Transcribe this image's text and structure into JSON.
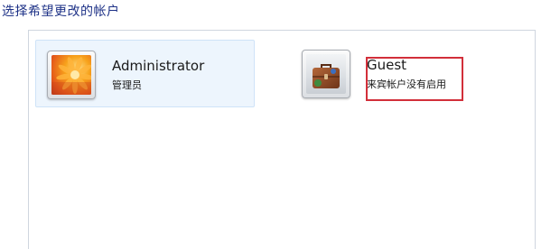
{
  "heading": "选择希望更改的帐户",
  "accounts": [
    {
      "name": "Administrator",
      "subtitle": "管理员",
      "picture": "flower-avatar-icon",
      "selected": true
    },
    {
      "name": "Guest",
      "subtitle": "来宾帐户没有启用",
      "picture": "briefcase-avatar-icon",
      "selected": false
    }
  ],
  "colors": {
    "heading": "#1e3287",
    "selected_background": "#edf5fd",
    "highlight_border": "#d22f3a",
    "panel_border": "#cfd6df"
  }
}
